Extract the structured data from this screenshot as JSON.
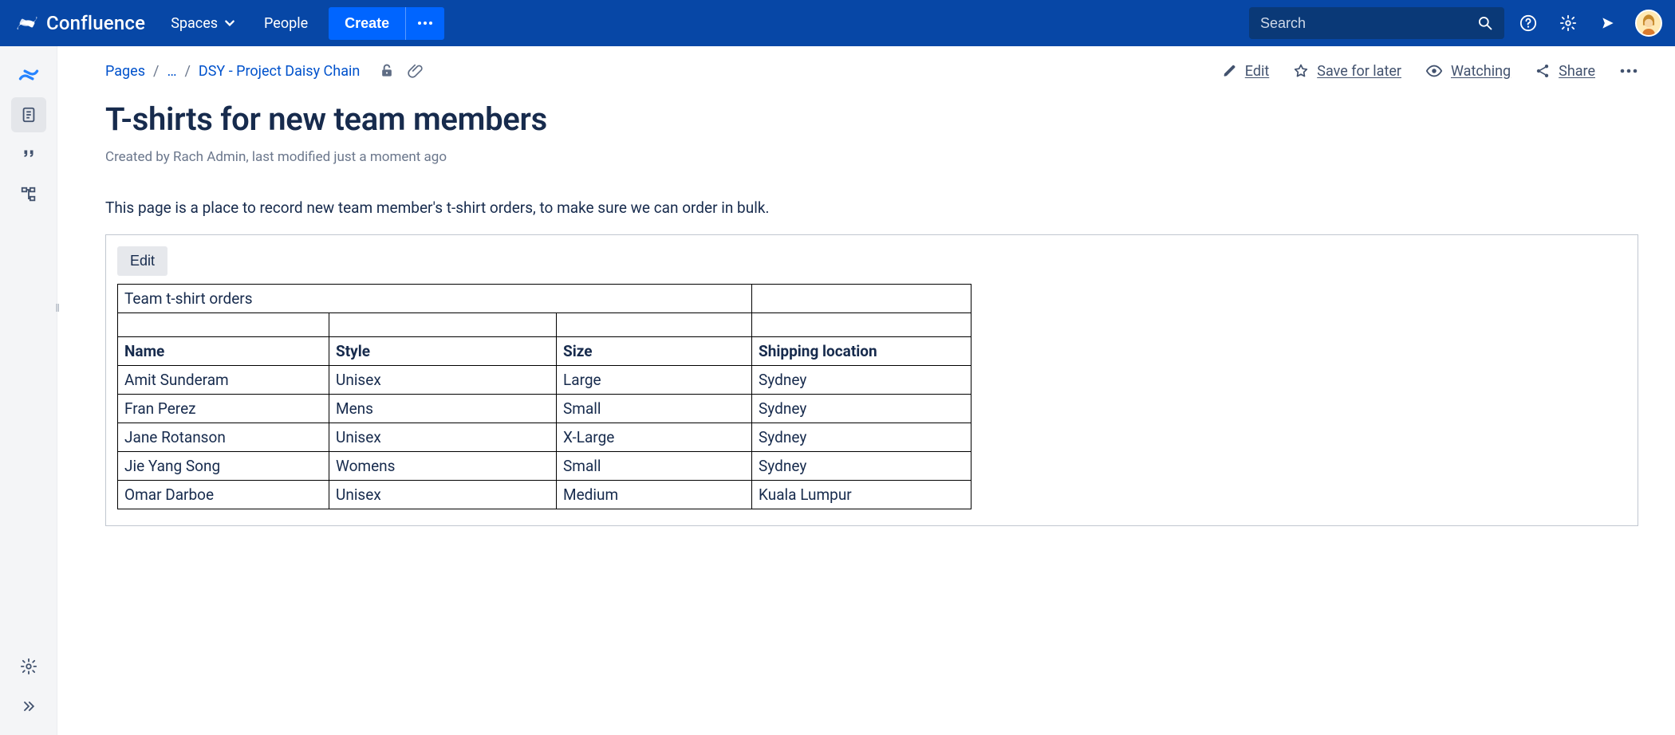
{
  "nav": {
    "brand": "Confluence",
    "spaces": "Spaces",
    "people": "People",
    "create": "Create"
  },
  "search": {
    "placeholder": "Search"
  },
  "breadcrumb": {
    "pages": "Pages",
    "ellipsis": "…",
    "parent": "DSY - Project Daisy Chain"
  },
  "actions": {
    "edit": "Edit",
    "save_for_later": "Save for later",
    "watching": "Watching",
    "share": "Share"
  },
  "page": {
    "title": "T-shirts for new team members",
    "byline": "Created by Rach Admin, last modified just a moment ago",
    "intro": "This page is a place to record new team member's t-shirt orders, to make sure we can order in bulk."
  },
  "panel": {
    "edit": "Edit",
    "sheet_title": "Team t-shirt orders"
  },
  "table": {
    "headers": {
      "name": "Name",
      "style": "Style",
      "size": "Size",
      "location": "Shipping location"
    },
    "rows": [
      {
        "name": "Amit Sunderam",
        "style": "Unisex",
        "size": "Large",
        "location": "Sydney"
      },
      {
        "name": "Fran Perez",
        "style": "Mens",
        "size": "Small",
        "location": "Sydney"
      },
      {
        "name": "Jane Rotanson",
        "style": "Unisex",
        "size": "X-Large",
        "location": "Sydney"
      },
      {
        "name": "Jie Yang Song",
        "style": "Womens",
        "size": "Small",
        "location": "Sydney"
      },
      {
        "name": "Omar Darboe",
        "style": "Unisex",
        "size": "Medium",
        "location": "Kuala Lumpur"
      }
    ]
  }
}
